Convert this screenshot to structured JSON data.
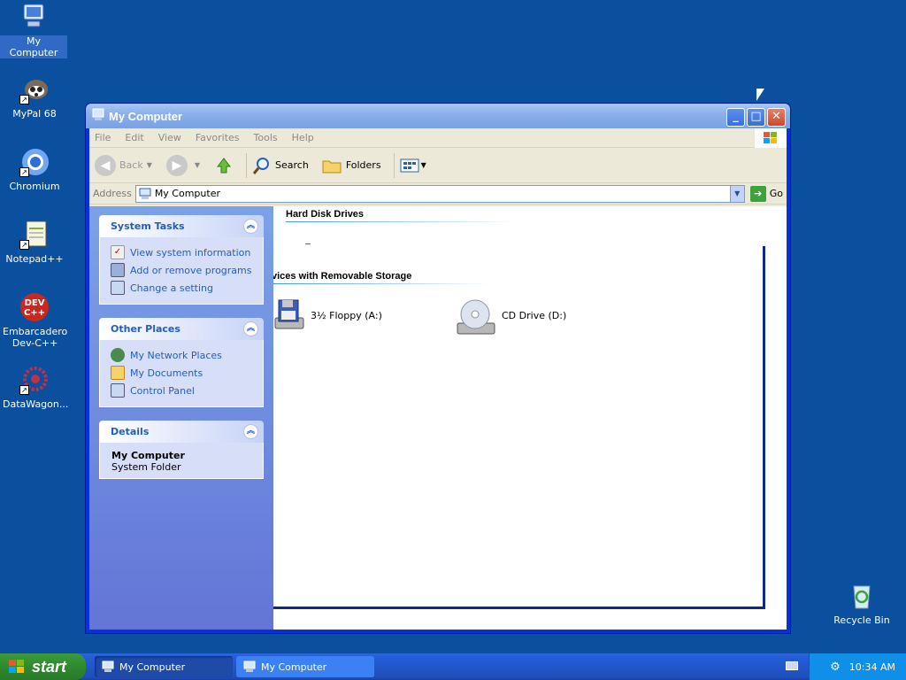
{
  "desktop": {
    "icons": [
      {
        "label": "My Computer",
        "icon": "computer-icon"
      },
      {
        "label": "MyPal 68",
        "icon": "mypal-icon"
      },
      {
        "label": "Chromium",
        "icon": "chromium-icon"
      },
      {
        "label": "Notepad++",
        "icon": "notepad-icon"
      },
      {
        "label": "Embarcadero Dev-C++",
        "icon": "devcpp-icon"
      },
      {
        "label": "DataWagon...",
        "icon": "datawagon-icon"
      },
      {
        "label": "Recycle Bin",
        "icon": "recycle-bin-icon"
      }
    ],
    "background_color": "#0b4f9f"
  },
  "window": {
    "title": "My Computer",
    "menu": [
      "File",
      "Edit",
      "View",
      "Favorites",
      "Tools",
      "Help"
    ],
    "toolbar": {
      "back": "Back",
      "search": "Search",
      "folders": "Folders"
    },
    "address": {
      "label": "Address",
      "value": "My Computer",
      "go": "Go"
    },
    "taskpane": {
      "system_tasks": {
        "title": "System Tasks",
        "items": [
          "View system information",
          "Add or remove programs",
          "Change a setting"
        ]
      },
      "other_places": {
        "title": "Other Places",
        "items": [
          "My Network Places",
          "My Documents",
          "Control Panel"
        ]
      },
      "details": {
        "title": "Details",
        "name": "My Computer",
        "type": "System Folder"
      }
    },
    "content": {
      "groups": [
        {
          "title": "Hard Disk Drives"
        },
        {
          "title": "vices with Removable Storage"
        }
      ],
      "drives": [
        {
          "label": "3½ Floppy (A:)",
          "icon": "floppy-icon"
        },
        {
          "label": "CD Drive (D:)",
          "icon": "cd-drive-icon"
        }
      ]
    }
  },
  "taskbar": {
    "start": "start",
    "buttons": [
      "My Computer",
      "My Computer"
    ],
    "clock": "10:34 AM"
  }
}
